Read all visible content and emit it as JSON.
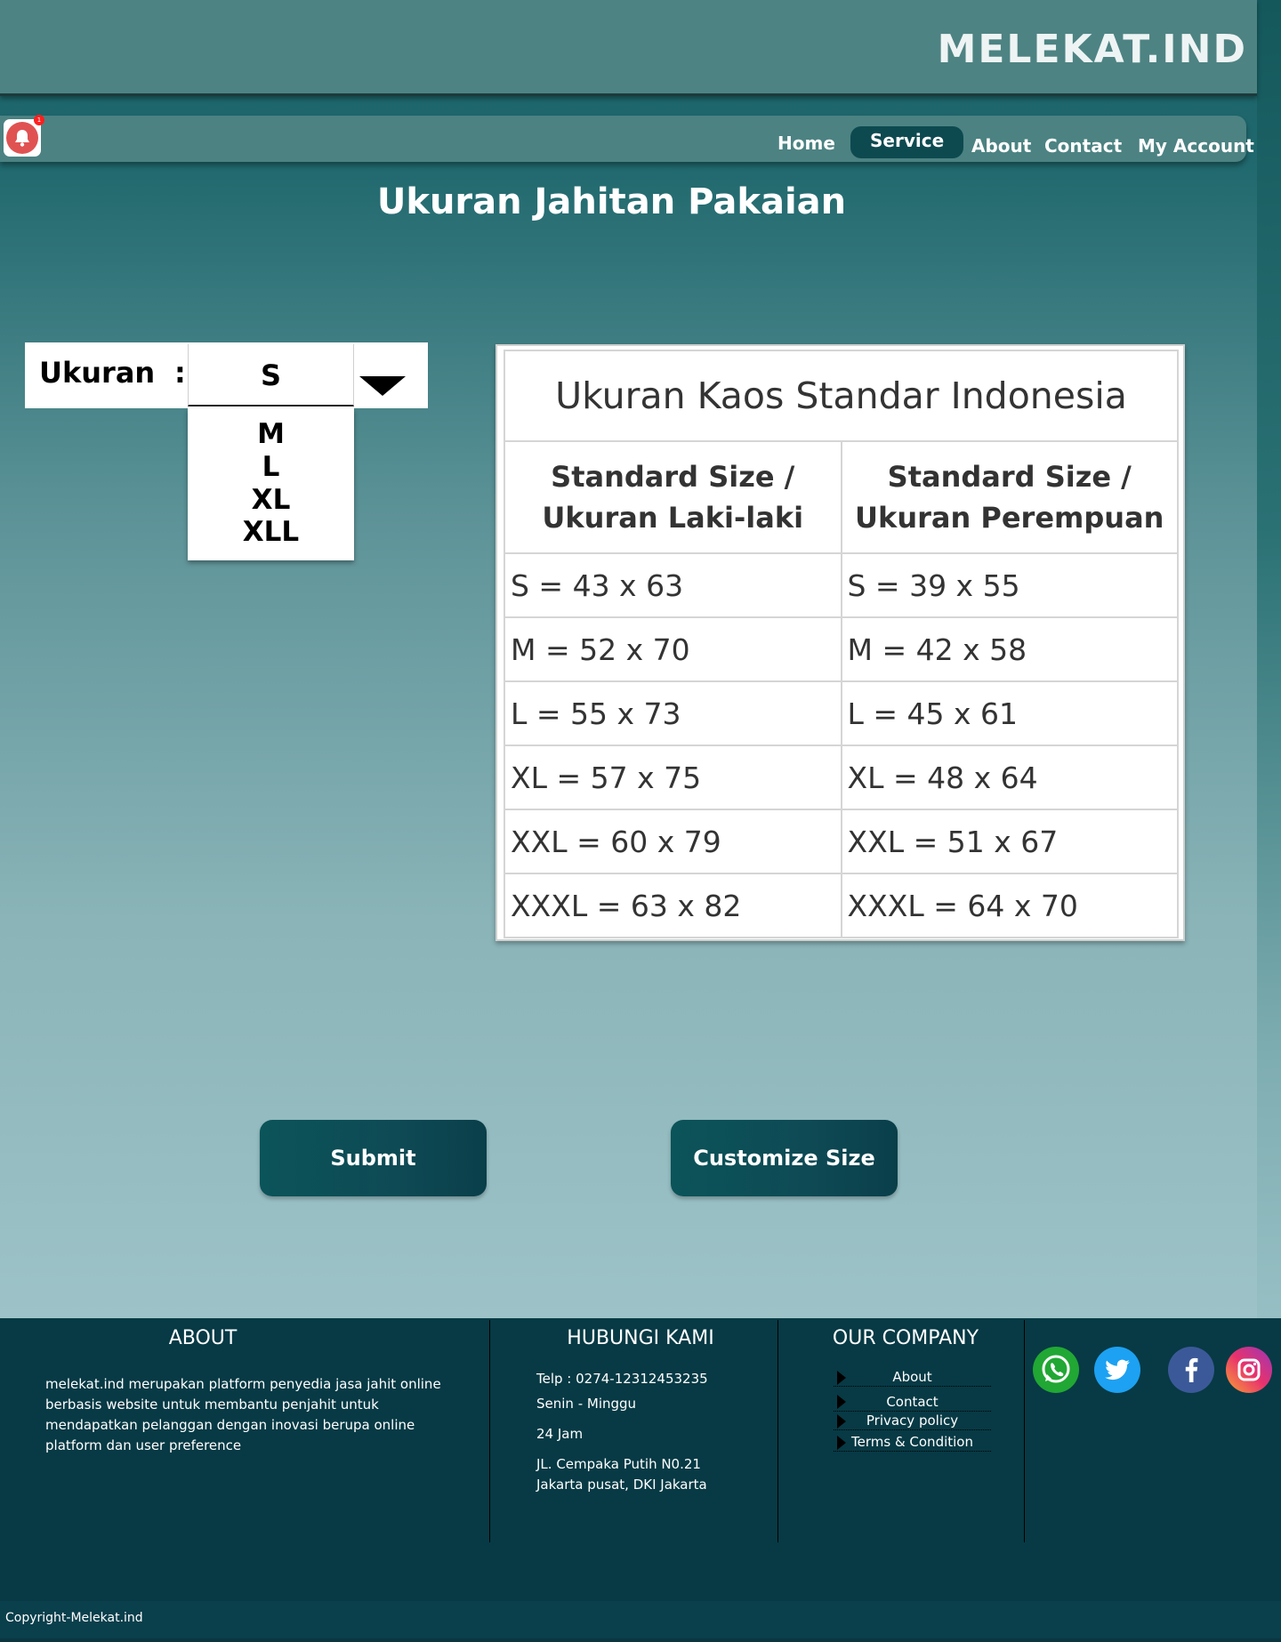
{
  "brand": "MELEKAT.IND",
  "nav": {
    "notification_count": "1",
    "items": [
      "Home",
      "Service",
      "About",
      "Contact",
      "My Account"
    ],
    "active": "Service"
  },
  "page_title": "Ukuran Jahitan Pakaian",
  "size_selector": {
    "label": "Ukuran",
    "colon": ":",
    "selected": "S",
    "options": [
      "M",
      "L",
      "XL",
      "XLL"
    ]
  },
  "size_table": {
    "title": "Ukuran Kaos Standar Indonesia",
    "headers": [
      [
        "Standard Size /",
        "Ukuran Laki-laki"
      ],
      [
        "Standard Size /",
        "Ukuran Perempuan"
      ]
    ],
    "rows": [
      [
        "S = 43 x 63",
        "S = 39 x 55"
      ],
      [
        "M = 52 x 70",
        "M = 42 x 58"
      ],
      [
        "L = 55 x 73",
        "L = 45 x 61"
      ],
      [
        "XL = 57 x 75",
        "XL = 48 x 64"
      ],
      [
        "XXL = 60 x 79",
        "XXL = 51 x 67"
      ],
      [
        "XXXL = 63 x 82",
        "XXXL = 64 x 70"
      ]
    ]
  },
  "buttons": {
    "submit": "Submit",
    "customize": "Customize Size"
  },
  "footer": {
    "about": {
      "heading": "ABOUT",
      "text": "melekat.ind merupakan platform penyedia jasa jahit online berbasis website untuk membantu penjahit untuk mendapatkan pelanggan dengan inovasi berupa online platform dan user preference"
    },
    "contact": {
      "heading": "HUBUNGI KAMI",
      "phone": "Telp  :  0274-12312453235",
      "days": "Senin - Minggu",
      "hours": "24 Jam",
      "address_line1": "JL. Cempaka Putih N0.21",
      "address_line2": "Jakarta pusat, DKI Jakarta"
    },
    "company": {
      "heading": "OUR COMPANY",
      "links": [
        "About",
        "Contact",
        "Privacy policy",
        "Terms & Condition"
      ]
    },
    "social_icons": [
      "whatsapp-icon",
      "twitter-icon",
      "facebook-icon",
      "instagram-icon"
    ],
    "copyright": "Copyright-Melekat.ind"
  },
  "colors": {
    "accent": "#0d4a50",
    "footer_bg": "#073a45",
    "notification": "#e05252"
  }
}
